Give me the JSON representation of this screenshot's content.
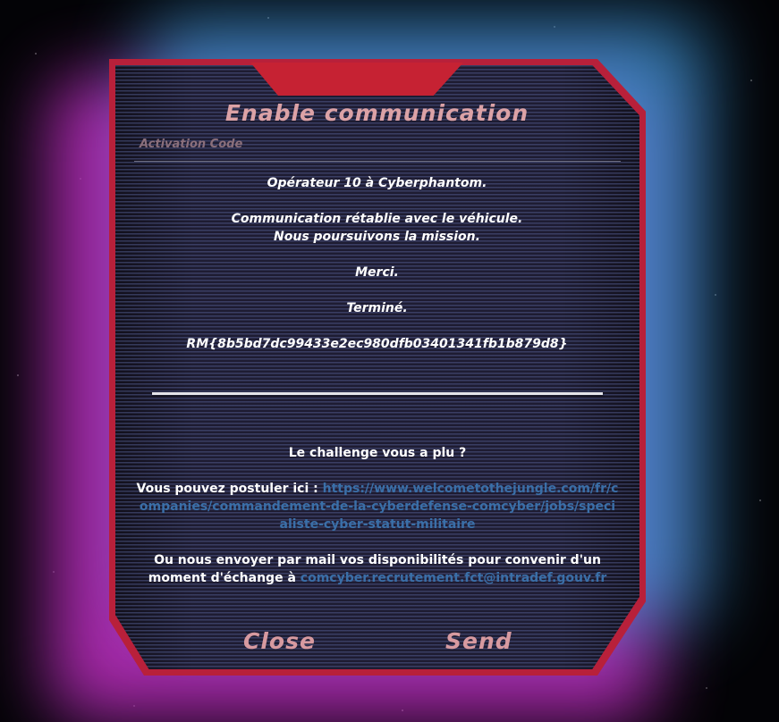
{
  "dialog": {
    "title": "Enable communication",
    "field_label": "Activation Code"
  },
  "message": {
    "line1": "Opérateur 10 à Cyberphantom.",
    "line2": "Communication rétablie avec le véhicule.",
    "line3": "Nous poursuivons la mission.",
    "line4": "Merci.",
    "line5": "Terminé.",
    "flag": "RM{8b5bd7dc99433e2ec980dfb03401341fb1b879d8}"
  },
  "recruit": {
    "question": "Le challenge vous a plu ?",
    "apply_prefix": "Vous pouvez postuler ici : ",
    "apply_link": "https://www.welcometothejungle.com/fr/companies/commandement-de-la-cyberdefense-comcyber/jobs/specialiste-cyber-statut-militaire",
    "mail_prefix": "Ou nous envoyer par mail vos disponibilités pour convenir d'un moment d'échange à ",
    "mail_link": "comcyber.recrutement.fct@intradef.gouv.fr"
  },
  "buttons": {
    "close": "Close",
    "send": "Send"
  },
  "colors": {
    "frame": "#b8203a",
    "glow_pink": "#c22fc4",
    "glow_blue": "#3c9ad8",
    "title": "#dca2a6",
    "link": "#3a6fa8"
  }
}
